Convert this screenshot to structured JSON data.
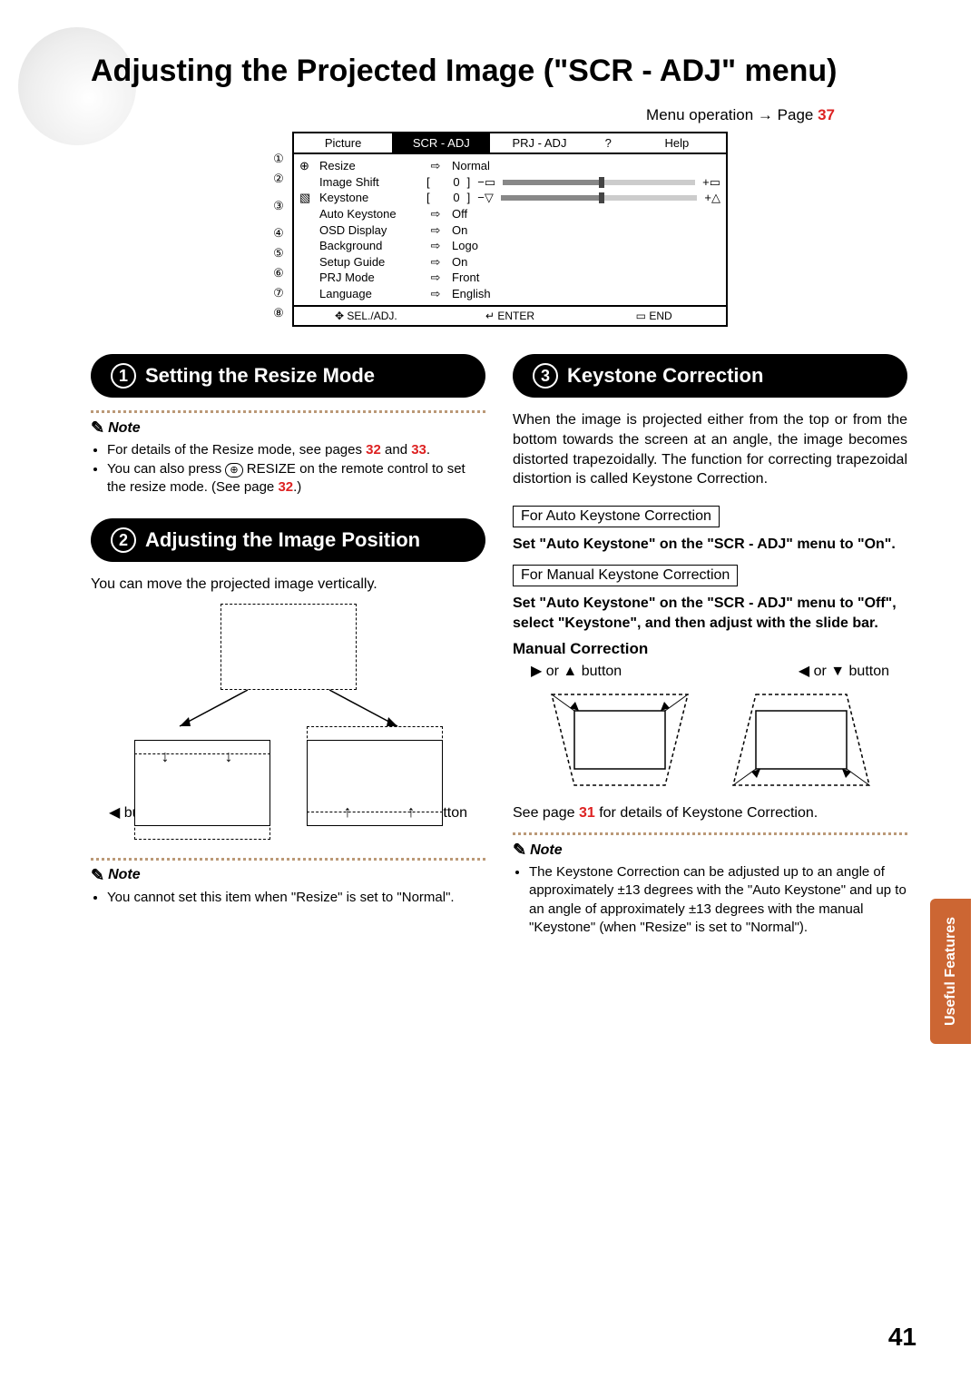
{
  "title": "Adjusting the Projected Image (\"SCR - ADJ\" menu)",
  "menu_operation": {
    "prefix": "Menu operation ",
    "arrow": "→",
    "page_word": " Page ",
    "page_num": "37"
  },
  "menu_table": {
    "tabs": [
      "Picture",
      "SCR - ADJ",
      "PRJ - ADJ",
      "?",
      "Help"
    ],
    "active_tab_index": 1,
    "callouts": [
      "①",
      "②",
      "③",
      "④",
      "⑤",
      "⑥",
      "⑦",
      "⑧"
    ],
    "rows": [
      {
        "icon": "⊕",
        "label": "Resize",
        "arrow": "⇨",
        "value": "Normal"
      },
      {
        "icon": "",
        "label": "Image Shift",
        "bracket": "[",
        "num": "0",
        "slider": true,
        "left_icon": "−▭",
        "right_icon": "+▭"
      },
      {
        "icon": "▧",
        "label": "Keystone",
        "bracket": "[",
        "num": "0",
        "slider": true,
        "left_icon": "−▽",
        "right_icon": "+△"
      },
      {
        "icon": "",
        "label": "Auto Keystone",
        "arrow": "⇨",
        "value": "Off"
      },
      {
        "icon": "",
        "label": "OSD Display",
        "arrow": "⇨",
        "value": "On"
      },
      {
        "icon": "",
        "label": "Background",
        "arrow": "⇨",
        "value": "Logo"
      },
      {
        "icon": "",
        "label": "Setup Guide",
        "arrow": "⇨",
        "value": "On"
      },
      {
        "icon": "",
        "label": "PRJ Mode",
        "arrow": "⇨",
        "value": "Front"
      },
      {
        "icon": "",
        "label": "Language",
        "arrow": "⇨",
        "value": "English"
      }
    ],
    "footer": {
      "sel": "✥ SEL./ADJ.",
      "enter": "↵ ENTER",
      "end": "▭ END"
    }
  },
  "section1": {
    "num": "1",
    "title": "Setting the Resize Mode",
    "note_label": "Note",
    "bullets": [
      {
        "pre": "For details of the Resize mode, see pages ",
        "r1": "32",
        "mid": " and ",
        "r2": "33",
        "post": "."
      },
      {
        "pre": "You can also press ",
        "btn": "⊕",
        "mid": " RESIZE on the remote control to set the resize mode. (See page ",
        "r1": "32",
        "post": ".)"
      }
    ]
  },
  "section2": {
    "num": "2",
    "title": "Adjusting the Image Position",
    "body": "You can move the projected image vertically.",
    "left_btn": "◀ button",
    "right_btn": "▶ button",
    "note_label": "Note",
    "note_bullet": "You cannot set this item when \"Resize\" is set to \"Normal\"."
  },
  "section3": {
    "num": "3",
    "title": "Keystone Correction",
    "intro": "When the image is projected either from the top or from the bottom towards the screen at an angle, the image becomes distorted trapezoidally. The function for correcting trapezoidal distortion is called Keystone Correction.",
    "box_auto": "For Auto Keystone Correction",
    "auto_set": "Set \"Auto Keystone\" on the \"SCR - ADJ\" menu to \"On\".",
    "box_manual": "For Manual Keystone Correction",
    "manual_set": "Set \"Auto Keystone\" on the \"SCR - ADJ\" menu to \"Off\", select \"Keystone\", and then adjust with the slide bar.",
    "manual_h": "Manual Correction",
    "btn_left": "▶ or ▲ button",
    "btn_right": "◀ or ▼ button",
    "see_page": {
      "pre": "See page ",
      "num": "31",
      "post": " for details of Keystone Correction."
    },
    "note_label": "Note",
    "note_bullet": "The Keystone Correction can be adjusted up to an angle of approximately ±13 degrees with the \"Auto Keystone\" and up to an angle of approximately ±13 degrees with the manual \"Keystone\" (when \"Resize\" is set to \"Normal\")."
  },
  "side_tab": "Useful Features",
  "page_number": "41"
}
